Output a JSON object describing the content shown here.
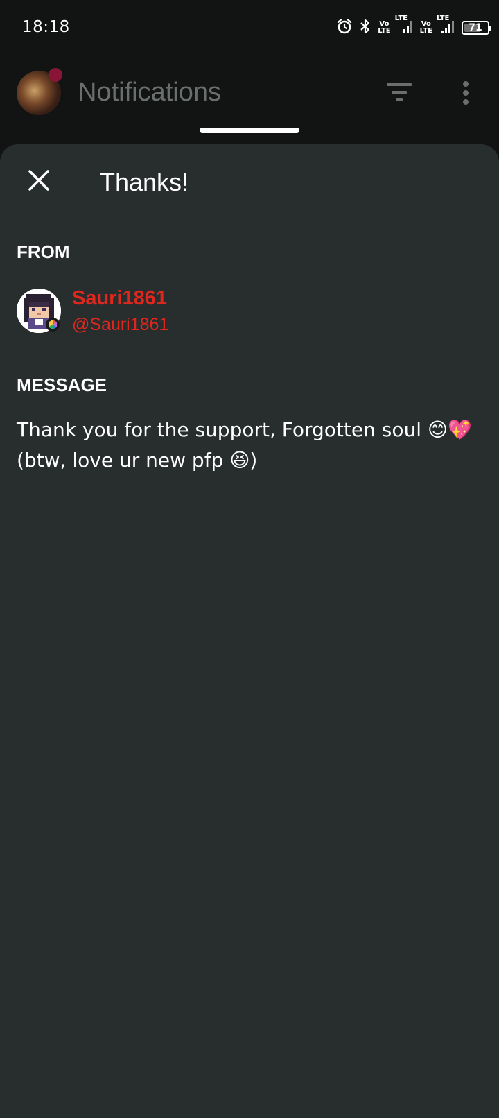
{
  "status_bar": {
    "time": "18:18",
    "icons": [
      "alarm-icon",
      "bluetooth-icon",
      "volte-icon",
      "signal-icon",
      "volte-icon",
      "signal-icon"
    ],
    "volte_top": "Vo",
    "volte_bottom": "LTE",
    "lte_label": "LTE",
    "battery": "71",
    "battery_level": 0.71
  },
  "header": {
    "title": "Notifications",
    "notification_dot_color": "#8a1438",
    "icons": [
      "filter-icon",
      "more-vertical-icon"
    ]
  },
  "sheet": {
    "title": "Thanks!",
    "from_label": "FROM",
    "sender": {
      "name": "Sauri1861",
      "handle": "@Sauri1861",
      "name_color": "#e0271e"
    },
    "message_label": "MESSAGE",
    "message": "Thank you for the support, Forgotten soul 😊💖 (btw, love ur new pfp 😆)"
  },
  "colors": {
    "background": "#121414",
    "sheet": "#282d2e",
    "accent_red": "#e0271e"
  }
}
